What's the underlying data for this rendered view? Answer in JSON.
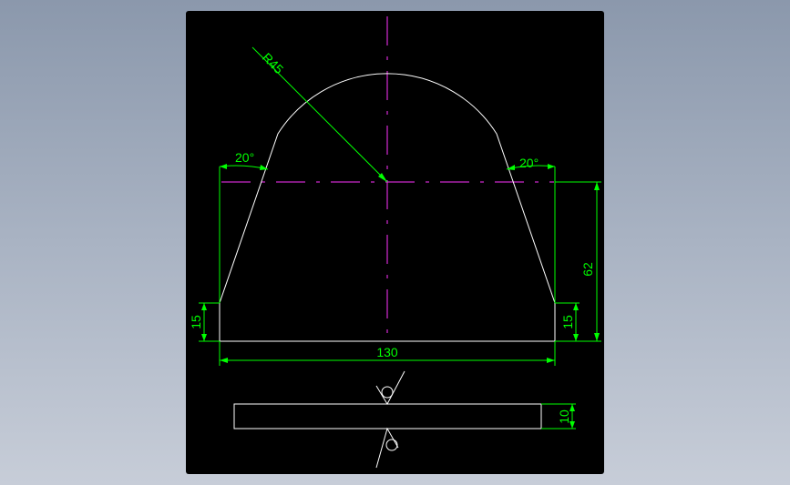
{
  "colors": {
    "background": "#000000",
    "outline": "#ffffff",
    "centerline": "#ff33ff",
    "dimension": "#00ff00",
    "text": "#00ff00"
  },
  "dimensions": {
    "radius": "R45",
    "angle_left": "20°",
    "angle_right": "20°",
    "height": "62",
    "edge_left": "15",
    "edge_right": "15",
    "width": "130",
    "thickness": "10"
  },
  "symbols": {
    "surface_finish_top": "surface-roughness-symbol",
    "surface_finish_bottom": "surface-roughness-symbol"
  }
}
